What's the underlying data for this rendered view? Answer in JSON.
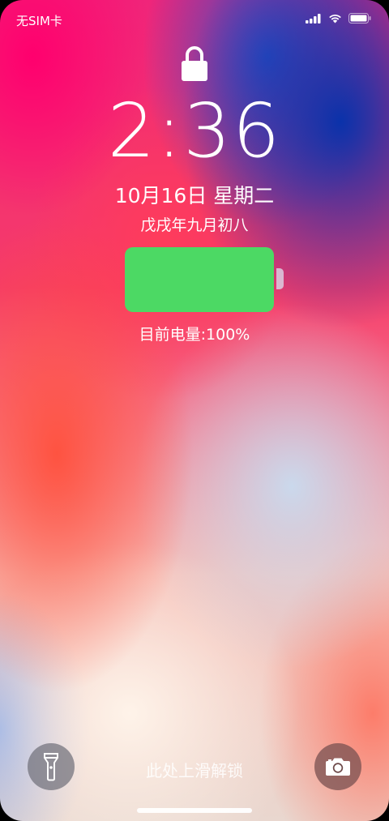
{
  "status_bar": {
    "carrier": "无SIM卡",
    "icons": [
      "signal-icon",
      "wifi-icon",
      "battery-icon"
    ]
  },
  "lock_screen": {
    "lock_icon": "lock-icon",
    "time": "2:36",
    "date": "10月16日 星期二",
    "lunar_date": "戊戌年九月初八",
    "battery": {
      "level_percent": 100,
      "label": "目前电量:100%",
      "color": "#4cd964"
    },
    "unlock_hint": "此处上滑解锁"
  },
  "bottom_controls": {
    "left_icon": "flashlight-icon",
    "right_icon": "camera-icon"
  }
}
